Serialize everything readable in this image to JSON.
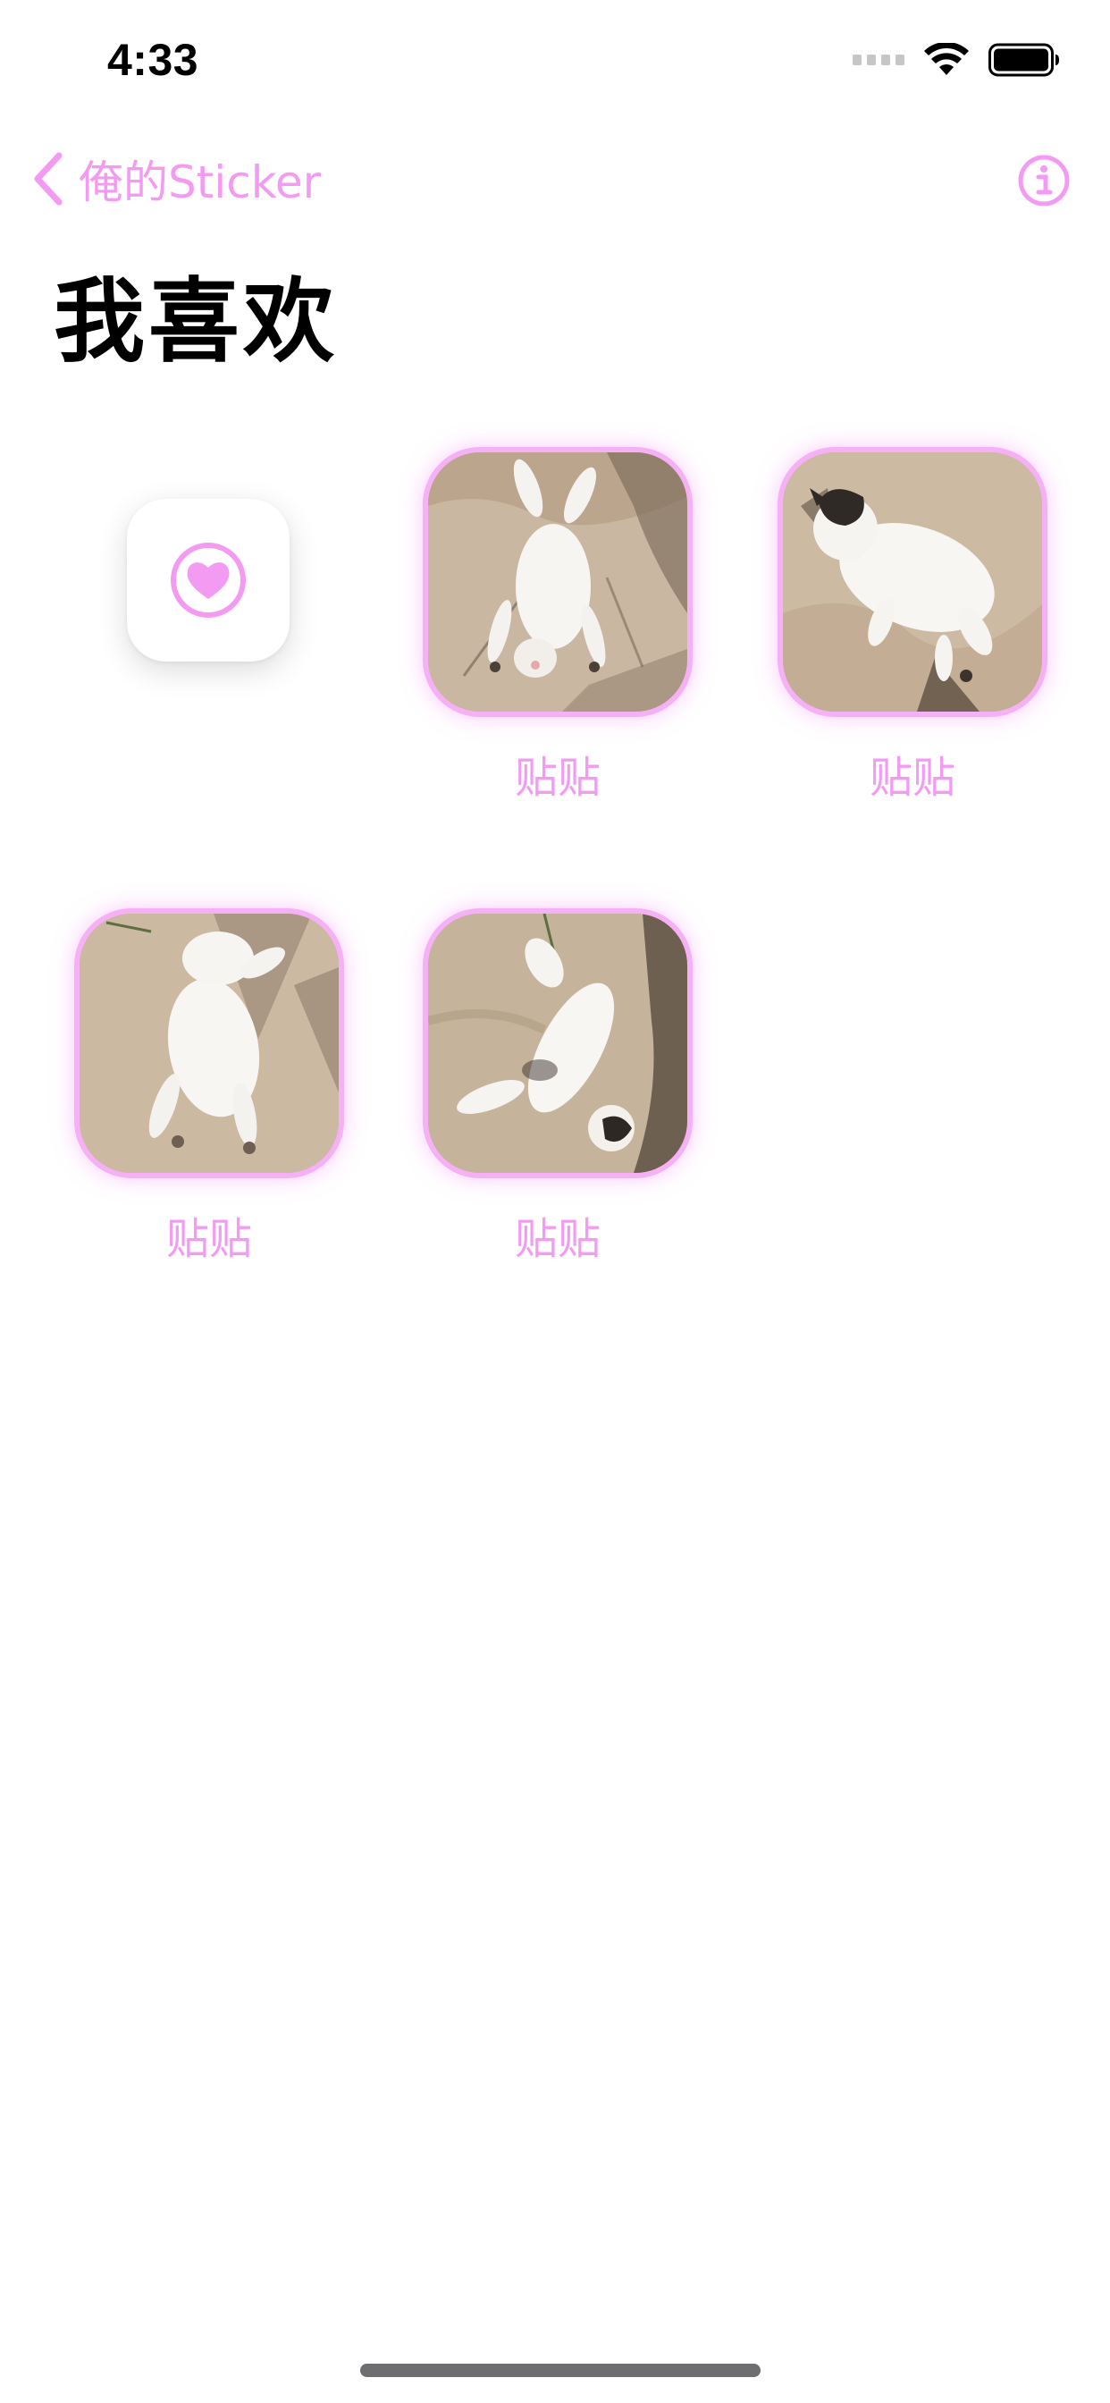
{
  "status_bar": {
    "time": "4:33",
    "icons": [
      "cellular-signal-icon",
      "wifi-icon",
      "battery-icon"
    ]
  },
  "nav": {
    "back_label": "俺的Sticker",
    "back_icon": "chevron-left-icon",
    "info_icon": "info-circle-icon"
  },
  "page_title": "我喜欢",
  "add_tile": {
    "icon": "heart-circle-icon"
  },
  "stickers": [
    {
      "label": "贴贴",
      "image": "cat-lying-on-back-photo"
    },
    {
      "label": "贴贴",
      "image": "cat-lying-on-side-photo"
    },
    {
      "label": "贴贴",
      "image": "cat-lying-belly-up-photo"
    },
    {
      "label": "贴贴",
      "image": "cat-stretched-out-photo"
    }
  ],
  "colors": {
    "accent": "#f39af3",
    "sticker_border": "#f6b1f6",
    "background": "#ffffff",
    "photo_ground": "#c8b5a0"
  }
}
